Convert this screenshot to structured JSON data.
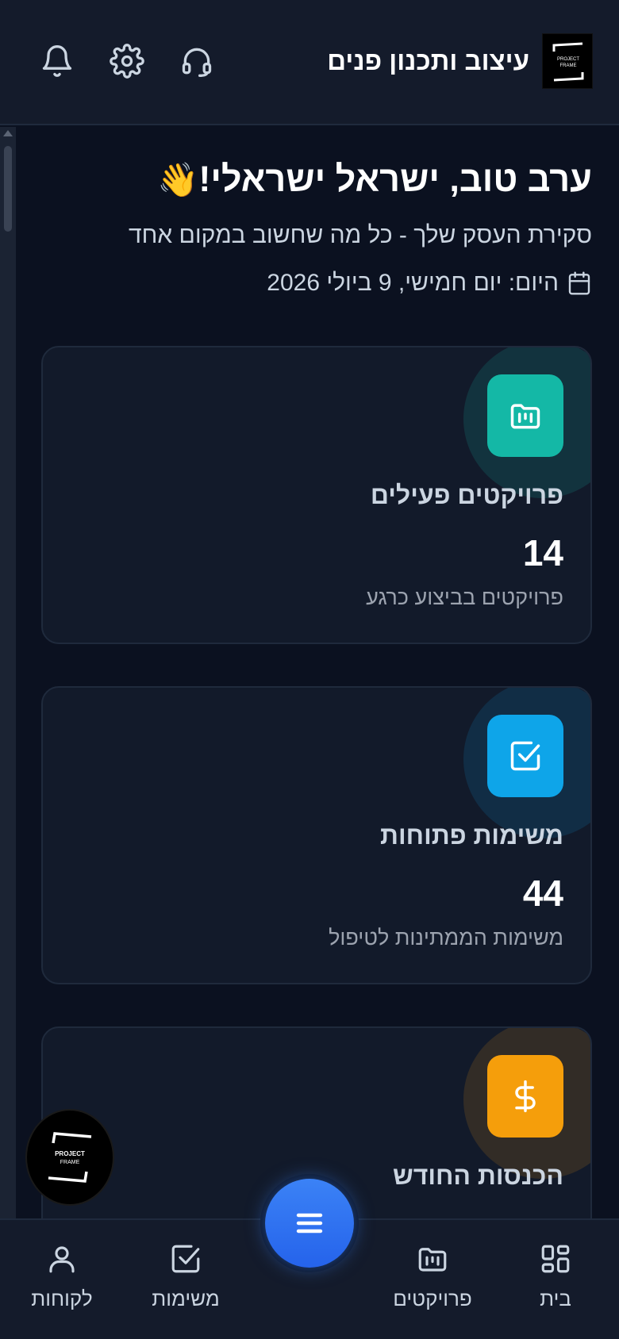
{
  "header": {
    "brand_title": "עיצוב ותכנון פנים",
    "logo_text": "PROJECT FRAME",
    "icons": [
      "headset-icon",
      "gear-icon",
      "bell-icon"
    ]
  },
  "welcome": {
    "greeting": "ערב טוב, ישראל ישראלי!",
    "wave_emoji": "👋",
    "subtitle": "סקירת העסק שלך - כל מה שחשוב במקום אחד",
    "date": "היום: יום חמישי, 9 ביולי 2026"
  },
  "cards": [
    {
      "title": "פרויקטים פעילים",
      "value": "14",
      "subtitle": "פרויקטים בביצוע כרגע",
      "icon": "folder-icon",
      "color": "#14b8a6"
    },
    {
      "title": "משימות פתוחות",
      "value": "44",
      "subtitle": "משימות הממתינות לטיפול",
      "icon": "checkbox-icon",
      "color": "#0ea5e9"
    },
    {
      "title": "הכנסות החודש",
      "value": "",
      "subtitle": "",
      "icon": "dollar-icon",
      "color": "#f59e0b"
    }
  ],
  "bottom_nav": {
    "items": [
      {
        "label": "בית",
        "icon": "grid-icon"
      },
      {
        "label": "פרויקטים",
        "icon": "folder-icon"
      },
      {
        "label": "משימות",
        "icon": "checkbox-icon"
      },
      {
        "label": "לקוחות",
        "icon": "user-icon"
      }
    ],
    "fab_icon": "menu-icon"
  },
  "colors": {
    "background": "#0b1120",
    "card": "#121a2a",
    "accent_blue": "#3b82f6",
    "teal": "#14b8a6",
    "sky": "#0ea5e9",
    "amber": "#f59e0b"
  }
}
